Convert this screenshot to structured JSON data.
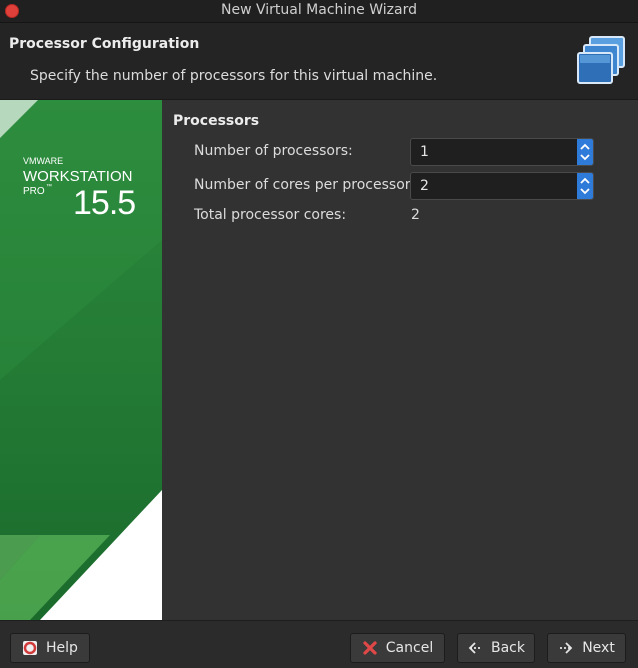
{
  "window": {
    "title": "New Virtual Machine Wizard"
  },
  "header": {
    "title": "Processor Configuration",
    "subtitle": "Specify the number of processors for this virtual machine.",
    "icon": "vm-stack-icon"
  },
  "banner": {
    "brand": "VMWARE",
    "product_line1": "WORKSTATION",
    "product_line2": "PRO",
    "trademark": "™",
    "version": "15.5",
    "colors": {
      "green_dark": "#1a5e2b",
      "green_light": "#4aa347"
    }
  },
  "processors": {
    "section_title": "Processors",
    "num_processors_label": "Number of processors:",
    "num_processors_value": "1",
    "cores_per_processor_label": "Number of cores per processor:",
    "cores_per_processor_value": "2",
    "total_cores_label": "Total processor cores:",
    "total_cores_value": "2"
  },
  "footer": {
    "help_label": "Help",
    "cancel_label": "Cancel",
    "back_label": "Back",
    "next_label": "Next"
  },
  "colors": {
    "accent": "#2f7bd9",
    "close": "#e0403a"
  }
}
